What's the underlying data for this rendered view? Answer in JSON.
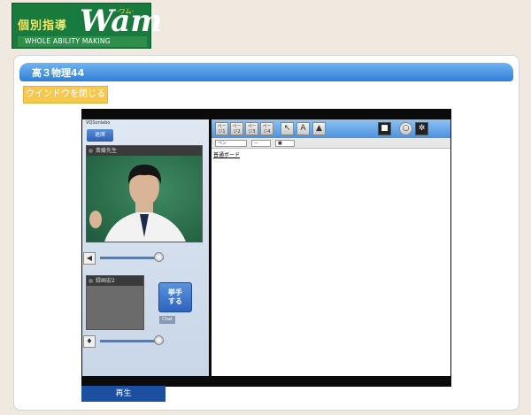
{
  "logo": {
    "jp_text": "個別指導",
    "brand": "Wam",
    "kana": "-ワム-",
    "tagline": "WHOLE ABILITY MAKING"
  },
  "page": {
    "title": "高３物理44",
    "close_window_label": "ウインドウを閉じる",
    "play_label": "再生"
  },
  "app": {
    "name": "VQSonlabo",
    "leave_label": "退席",
    "teacher_label": "斎藤先生",
    "recording_label": "録画宏2",
    "raise_hand_label": "挙手\nする",
    "chat_label": "Chat",
    "pen_label": "ペン",
    "board_link_label": "普通ボード",
    "toolbar_pages": [
      "ページ1",
      "ページ2",
      "ページ3",
      "ページ4"
    ],
    "audio_level": 0.92,
    "mic_level": 0.92
  }
}
